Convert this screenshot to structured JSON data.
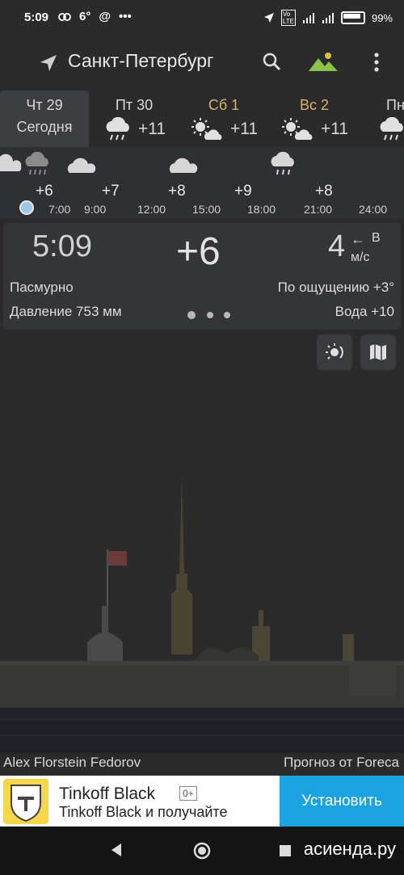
{
  "status_bar": {
    "time": "5:09",
    "temp_indicator": "6°",
    "battery": "99%",
    "icons": [
      "link-icon",
      "at-icon",
      "more-dots-icon",
      "location-arrow-icon",
      "volte-icon",
      "signal-4g-icon",
      "signal-icon",
      "battery-icon"
    ]
  },
  "app_bar": {
    "city": "Санкт-Петербург",
    "icons": [
      "location-arrow-icon",
      "search-icon",
      "landscape-icon",
      "more-vert-icon"
    ]
  },
  "days": [
    {
      "name": "Чт 29",
      "sub": "Сегодня",
      "temp": ""
    },
    {
      "name": "Пт 30",
      "icon": "rain-cloud-icon",
      "temp": "+11"
    },
    {
      "name": "Сб 1",
      "icon": "sun-cloud-icon",
      "temp": "+11"
    },
    {
      "name": "Вс 2",
      "icon": "sun-cloud-icon",
      "temp": "+11"
    },
    {
      "name": "Пн",
      "icon": "rain-cloud-icon",
      "temp": ""
    }
  ],
  "hourly": {
    "temps": [
      "+6",
      "+7",
      "+8",
      "+9",
      "+8"
    ],
    "times": [
      "7:00",
      "9:00",
      "12:00",
      "15:00",
      "18:00",
      "21:00",
      "24:00"
    ]
  },
  "current": {
    "time": "5:09",
    "temp": "+6",
    "wind_speed": "4",
    "wind_dir": "В",
    "wind_unit": "м/с",
    "condition": "Пасмурно",
    "feels_like": "По ощущению +3°",
    "pressure": "Давление 753 мм",
    "water": "Вода +10"
  },
  "tools": [
    "sun-radar-icon",
    "map-icon"
  ],
  "credits": {
    "photo": "Alex Florstein Fedorov",
    "forecast": "Прогноз от Foreca"
  },
  "ad": {
    "title": "Tinkoff Black",
    "age": "0+",
    "subtitle": "Tinkoff Black и получайте",
    "button": "Установить"
  },
  "watermark": "асиенда.ру",
  "colors": {
    "background": "#2b2b2c",
    "weekend": "#d6b46a",
    "install_button": "#1aa3e0",
    "landscape_icon": "#8bc34a"
  }
}
